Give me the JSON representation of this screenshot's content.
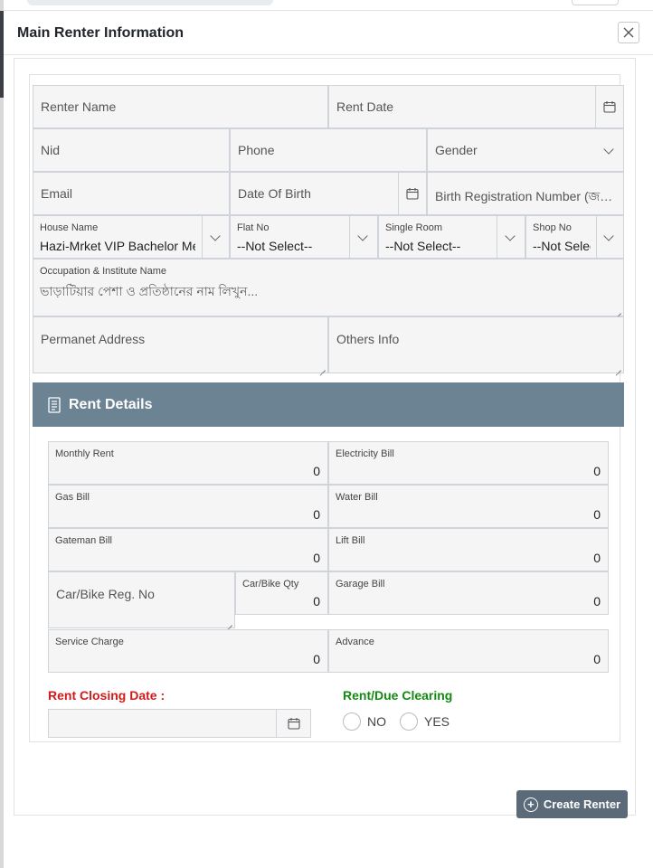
{
  "modal": {
    "title": "Main Renter Information"
  },
  "form": {
    "renter_name_placeholder": "Renter Name",
    "rent_date_placeholder": "Rent Date",
    "nid_placeholder": "Nid",
    "phone_placeholder": "Phone",
    "gender_placeholder": "Gender",
    "email_placeholder": "Email",
    "dob_placeholder": "Date Of Birth",
    "birth_reg_placeholder": "Birth Registration Number (জন্ম নিবন্ধন নম্বর)",
    "house_name_label": "House Name",
    "house_name_value": "Hazi-Mrket VIP Bachelor Mess",
    "flat_no_label": "Flat No",
    "flat_no_value": "--Not Select--",
    "single_room_label": "Single Room",
    "single_room_value": "--Not Select--",
    "shop_no_label": "Shop No",
    "shop_no_value": "--Not Select--",
    "occupation_label": "Occupation & Institute Name",
    "occupation_placeholder": "ভাড়াটিয়ার পেশা ও প্রতিষ্ঠানের নাম লিখুন...",
    "permanent_address_placeholder": "Permanet Address",
    "others_info_placeholder": "Others Info"
  },
  "rent_details": {
    "title": "Rent Details",
    "monthly_rent_label": "Monthly Rent",
    "monthly_rent_value": "0",
    "electricity_bill_label": "Electricity Bill",
    "electricity_bill_value": "0",
    "gas_bill_label": "Gas Bill",
    "gas_bill_value": "0",
    "water_bill_label": "Water Bill",
    "water_bill_value": "0",
    "gateman_bill_label": "Gateman Bill",
    "gateman_bill_value": "0",
    "lift_bill_label": "Lift Bill",
    "lift_bill_value": "0",
    "car_reg_placeholder": "Car/Bike Reg. No",
    "car_qty_label": "Car/Bike Qty",
    "car_qty_value": "0",
    "garage_bill_label": "Garage Bill",
    "garage_bill_value": "0",
    "service_charge_label": "Service Charge",
    "service_charge_value": "0",
    "advance_label": "Advance",
    "advance_value": "0",
    "closing_date_label": "Rent Closing Date :",
    "clearing_label": "Rent/Due Clearing",
    "option_no": "NO",
    "option_yes": "YES"
  },
  "actions": {
    "create_label": "Create Renter"
  },
  "icons": [
    "close-icon",
    "calendar-icon",
    "chevron-down-icon",
    "receipt-icon",
    "plus-circle-icon",
    "resize-handle-icon"
  ],
  "colors": {
    "rent_header_bg": "#6c8394",
    "closing_label": "#d11a1a",
    "clearing_label": "#128a12",
    "create_button_bg": "#5a6a78"
  }
}
